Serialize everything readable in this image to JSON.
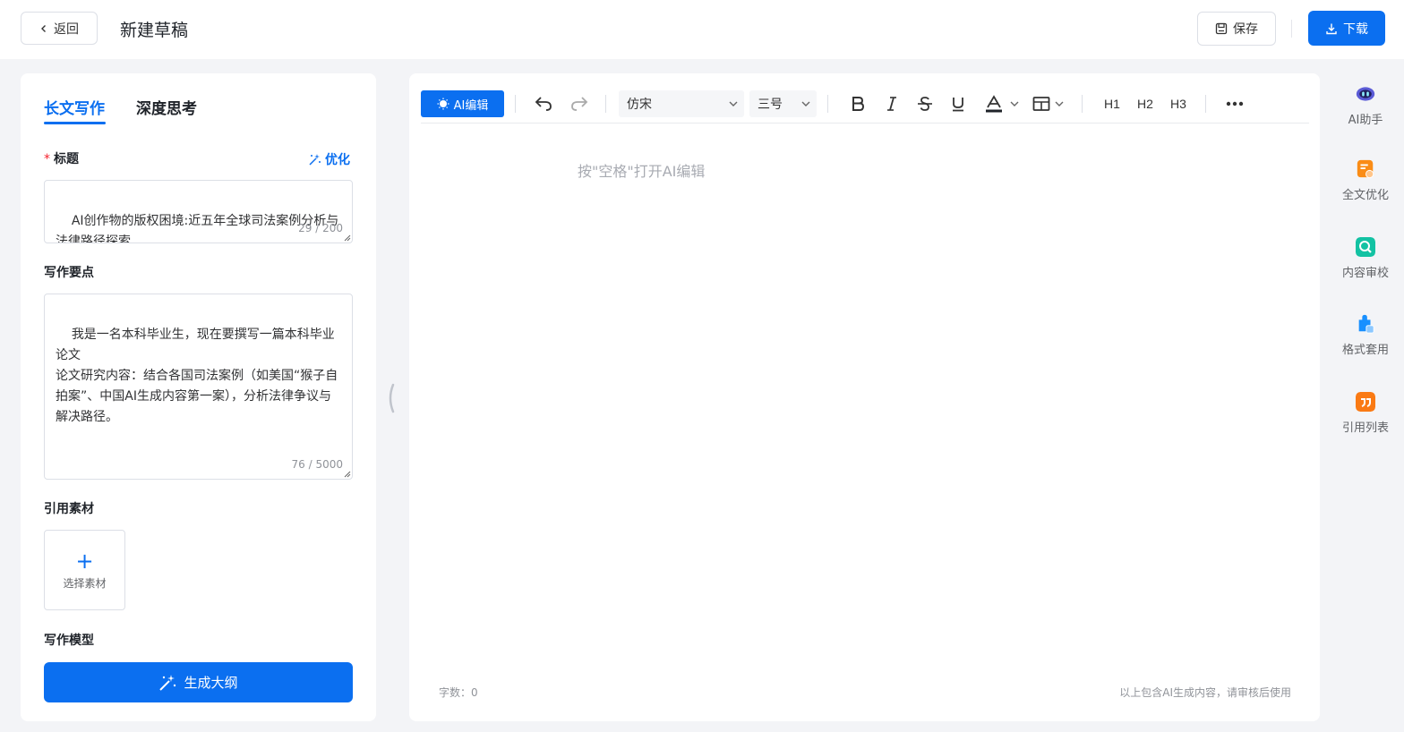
{
  "header": {
    "back_label": "返回",
    "title": "新建草稿",
    "save_label": "保存",
    "download_label": "下载"
  },
  "left_panel": {
    "tabs": [
      {
        "label": "长文写作",
        "active": true
      },
      {
        "label": "深度思考",
        "active": false
      }
    ],
    "title_field": {
      "required_mark": "*",
      "label": "标题",
      "optimize_label": "优化",
      "value": "AI创作物的版权困境:近五年全球司法案例分析与法律路径探索",
      "counter": "29 / 200"
    },
    "points_field": {
      "label": "写作要点",
      "value": "我是一名本科毕业生，现在要撰写一篇本科毕业论文\n论文研究内容：结合各国司法案例（如美国“猴子自拍案”、中国AI生成内容第一案），分析法律争议与解决路径。",
      "counter": "76 / 5000"
    },
    "material": {
      "label": "引用素材",
      "select_label": "选择素材"
    },
    "model_label": "写作模型",
    "generate_label": "生成大纲"
  },
  "editor": {
    "ai_edit_label": "AI编辑",
    "font_family": "仿宋",
    "font_size": "三号",
    "headings": [
      "H1",
      "H2",
      "H3"
    ],
    "placeholder": "按\"空格\"打开AI编辑",
    "word_count": "字数：0",
    "disclaimer": "以上包含AI生成内容，请审核后使用"
  },
  "right_rail": {
    "items": [
      {
        "label": "AI助手",
        "icon": "robot-icon",
        "color": "#5b5bd6"
      },
      {
        "label": "全文优化",
        "icon": "doc-optimize-icon",
        "color": "#fa8c16"
      },
      {
        "label": "内容审校",
        "icon": "search-review-icon",
        "color": "#13c2a3"
      },
      {
        "label": "格式套用",
        "icon": "format-apply-icon",
        "color": "#1890ff"
      },
      {
        "label": "引用列表",
        "icon": "quote-icon",
        "color": "#fa7a14"
      }
    ]
  },
  "colors": {
    "accent": "#0b6ff0",
    "background": "#f3f4f7"
  }
}
